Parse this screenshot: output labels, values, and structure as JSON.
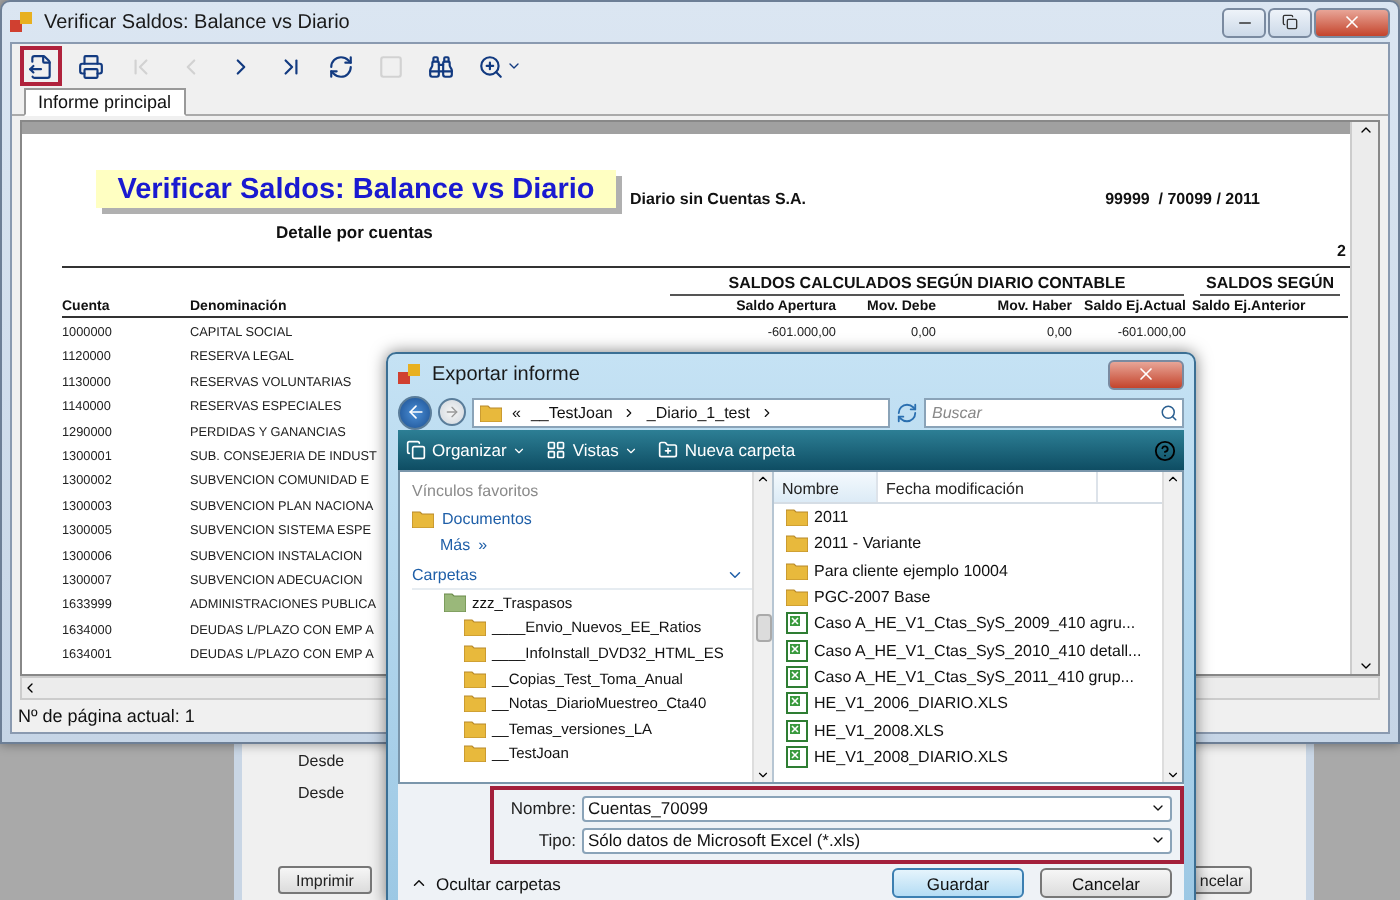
{
  "main_window": {
    "title": "Verificar Saldos: Balance vs Diario",
    "toolbar": [
      {
        "kind": "export",
        "disabled": false,
        "highlighted": true
      },
      {
        "kind": "print",
        "disabled": false,
        "highlighted": false
      },
      {
        "kind": "first",
        "disabled": true,
        "highlighted": false
      },
      {
        "kind": "previous",
        "disabled": true,
        "highlighted": false
      },
      {
        "kind": "next",
        "disabled": false,
        "highlighted": false
      },
      {
        "kind": "last",
        "disabled": false,
        "highlighted": false
      },
      {
        "kind": "refresh",
        "disabled": false,
        "highlighted": false
      },
      {
        "kind": "stop",
        "disabled": true,
        "highlighted": false
      },
      {
        "kind": "find",
        "disabled": false,
        "highlighted": false
      },
      {
        "kind": "zoom",
        "disabled": false,
        "highlighted": false
      }
    ],
    "tabs": [
      {
        "label": "Informe principal",
        "selected": true
      }
    ],
    "report": {
      "title": "Verificar Saldos: Balance vs Diario",
      "company": "Diario sin Cuentas S.A.",
      "code": "99999  / 70099 / 2011",
      "subtitle": "Detalle por cuentas",
      "page_mark": "2",
      "group_headers": [
        "SALDOS CALCULADOS SEGÚN DIARIO CONTABLE",
        "SALDOS SEGÚN"
      ],
      "columns": [
        "Cuenta",
        "Denominación",
        "Saldo Apertura",
        "Mov. Debe",
        "Mov. Haber",
        "Saldo Ej.Actual",
        "Saldo Ej.Anterior"
      ],
      "rows": [
        {
          "cuenta": "1000000",
          "denominacion": "CAPITAL SOCIAL",
          "values": [
            "-601.000,00",
            "0,00",
            "0,00",
            "-601.000,00"
          ]
        },
        {
          "cuenta": "1120000",
          "denominacion": "RESERVA LEGAL"
        },
        {
          "cuenta": "1130000",
          "denominacion": "RESERVAS VOLUNTARIAS"
        },
        {
          "cuenta": "1140000",
          "denominacion": "RESERVAS ESPECIALES"
        },
        {
          "cuenta": "1290000",
          "denominacion": "PERDIDAS Y GANANCIAS"
        },
        {
          "cuenta": "1300001",
          "denominacion": "SUB. CONSEJERIA DE INDUST"
        },
        {
          "cuenta": "1300002",
          "denominacion": "SUBVENCION COMUNIDAD E"
        },
        {
          "cuenta": "1300003",
          "denominacion": "SUBVENCION PLAN NACIONA"
        },
        {
          "cuenta": "1300005",
          "denominacion": "SUBVENCION SISTEMA ESPE"
        },
        {
          "cuenta": "1300006",
          "denominacion": "SUBVENCION INSTALACION"
        },
        {
          "cuenta": "1300007",
          "denominacion": "SUBVENCION ADECUACION"
        },
        {
          "cuenta": "1633999",
          "denominacion": "ADMINISTRACIONES PUBLICA"
        },
        {
          "cuenta": "1634000",
          "denominacion": "DEUDAS L/PLAZO CON EMP A"
        },
        {
          "cuenta": "1634001",
          "denominacion": "DEUDAS L/PLAZO CON EMP A"
        }
      ]
    },
    "status_bar": "Nº de página actual: 1"
  },
  "background_window": {
    "labels": [
      "Desde",
      "Desde"
    ],
    "buttons": [
      "Imprimir",
      "ncelar"
    ]
  },
  "dialog": {
    "title": "Exportar informe",
    "address": {
      "overflow": "«",
      "path": [
        "__TestJoan",
        "_Diario_1_test"
      ]
    },
    "search": {
      "placeholder": "Buscar"
    },
    "toolbar": [
      "Organizar",
      "Vistas",
      "Nueva carpeta"
    ],
    "favorites": {
      "header": "Vínculos favoritos",
      "links": [
        {
          "label": "Documentos",
          "kind": "folder"
        },
        {
          "label": "Más",
          "suffix": "»"
        }
      ]
    },
    "folders": {
      "header": "Carpetas",
      "tree": [
        {
          "name": "zzz_Traspasos",
          "children": [
            {
              "name": "____Envio_Nuevos_EE_Ratios"
            },
            {
              "name": "____InfoInstall_DVD32_HTML_ES"
            },
            {
              "name": "__Copias_Test_Toma_Anual"
            },
            {
              "name": "__Notas_DiarioMuestreo_Cta40"
            },
            {
              "name": "__Temas_versiones_LA"
            },
            {
              "name": "__TestJoan"
            }
          ]
        }
      ]
    },
    "file_columns": [
      "Nombre",
      "Fecha modificación"
    ],
    "files": [
      {
        "kind": "folder",
        "name": "2011"
      },
      {
        "kind": "folder",
        "name": "2011 - Variante"
      },
      {
        "kind": "folder",
        "name": "Para cliente ejemplo 10004"
      },
      {
        "kind": "folder",
        "name": "PGC-2007 Base"
      },
      {
        "kind": "excel",
        "name": "Caso A_HE_V1_Ctas_SyS_2009_410 agru..."
      },
      {
        "kind": "excel",
        "name": "Caso A_HE_V1_Ctas_SyS_2010_410 detall..."
      },
      {
        "kind": "excel",
        "name": "Caso A_HE_V1_Ctas_SyS_2011_410 grup..."
      },
      {
        "kind": "excel",
        "name": "HE_V1_2006_DIARIO.XLS"
      },
      {
        "kind": "excel",
        "name": "HE_V1_2008.XLS"
      },
      {
        "kind": "excel",
        "name": "HE_V1_2008_DIARIO.XLS"
      }
    ],
    "fields": {
      "highlighted": true,
      "items": [
        {
          "label": "Nombre:",
          "value": "Cuentas_70099"
        },
        {
          "label": "Tipo:",
          "value": "Sólo datos de Microsoft Excel (*.xls)"
        }
      ]
    },
    "hide_folders": "Ocultar carpetas",
    "buttons": [
      {
        "label": "Guardar",
        "default": true
      },
      {
        "label": "Cancelar",
        "default": false
      }
    ]
  }
}
